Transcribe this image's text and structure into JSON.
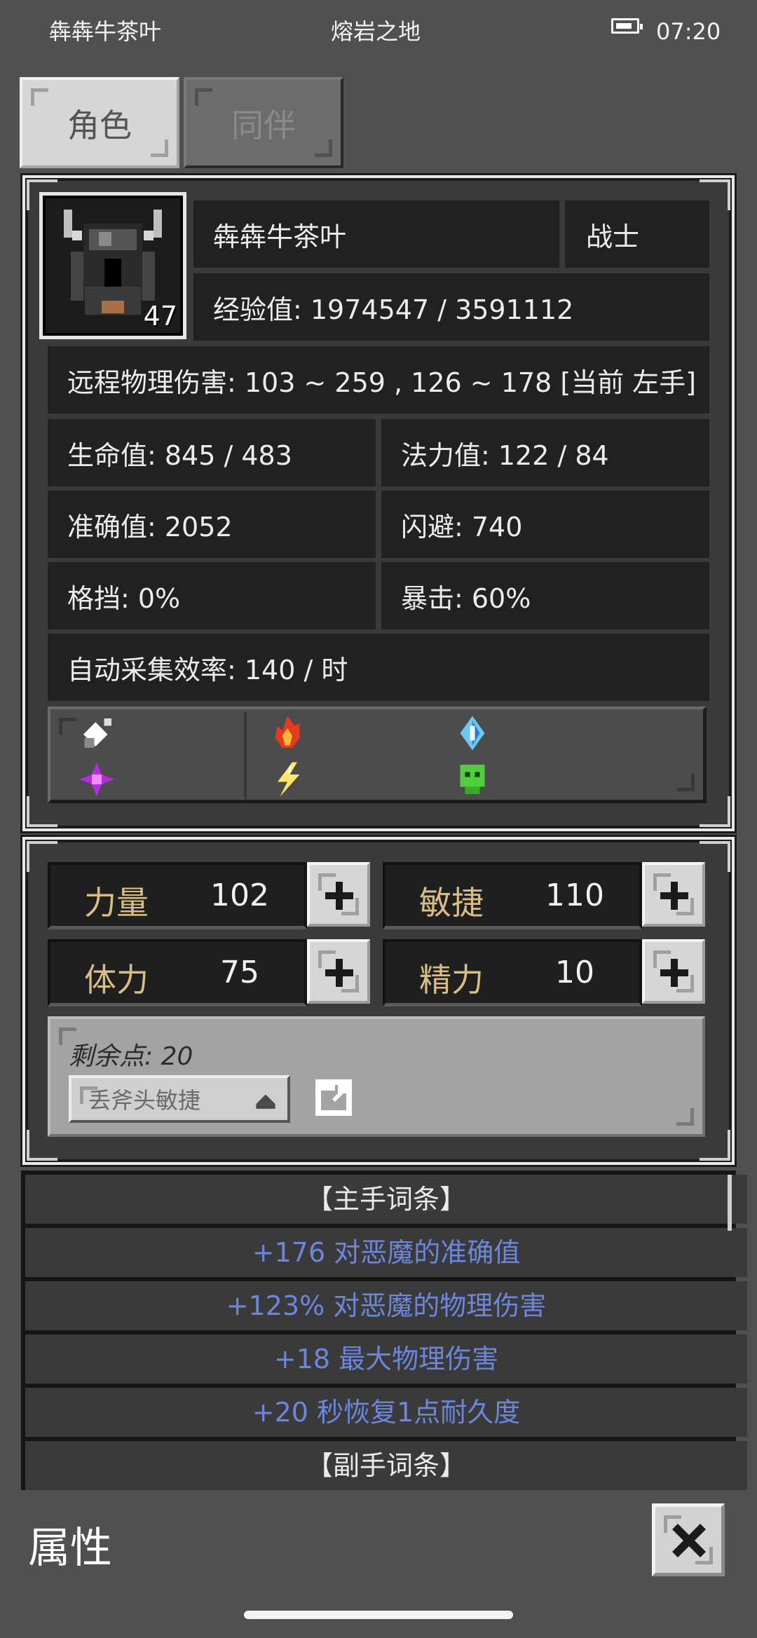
{
  "status_bar": {
    "left_text": "犇犇牛茶叶",
    "center_text": "熔岩之地",
    "time": "07:20",
    "battery_icon": "battery-icon"
  },
  "tabs": [
    {
      "label": "角色",
      "active": true
    },
    {
      "label": "同伴",
      "active": false
    }
  ],
  "character": {
    "name": "犇犇牛茶叶",
    "class": "战士",
    "level": "47",
    "experience": "经验值: 1974547 / 3591112",
    "ranged_damage": "远程物理伤害: 103 ~ 259 , 126 ~ 178 [当前 左手]",
    "hp": "生命值: 845 / 483",
    "mp": "法力值: 122 / 84",
    "accuracy": "准确值: 2052",
    "dodge": "闪避: 740",
    "block": "格挡: 0%",
    "crit": "暴击: 60%",
    "gather_rate": "自动采集效率: 140 / 时"
  },
  "element_icons": [
    "physical-sword-icon",
    "fire-icon",
    "ice-icon",
    "arcane-icon",
    "lightning-icon",
    "poison-skull-icon"
  ],
  "attributes": [
    {
      "label": "力量",
      "value": "102"
    },
    {
      "label": "敏捷",
      "value": "110"
    },
    {
      "label": "体力",
      "value": "75"
    },
    {
      "label": "精力",
      "value": "10"
    }
  ],
  "remaining_points": "剩余点: 20",
  "preset": {
    "name": "丢斧头敏捷",
    "dropdown_icon": "triangle-up-icon",
    "edit_icon": "export-icon"
  },
  "affixes": [
    {
      "text": "【主手词条】",
      "type": "header"
    },
    {
      "text": "+176 对恶魔的准确值",
      "type": "bonus"
    },
    {
      "text": "+123% 对恶魔的物理伤害",
      "type": "bonus"
    },
    {
      "text": "+18 最大物理伤害",
      "type": "bonus"
    },
    {
      "text": "+20 秒恢复1点耐久度",
      "type": "bonus"
    },
    {
      "text": "【副手词条】",
      "type": "header"
    }
  ],
  "footer": {
    "title": "属性",
    "close_icon": "close-icon"
  }
}
